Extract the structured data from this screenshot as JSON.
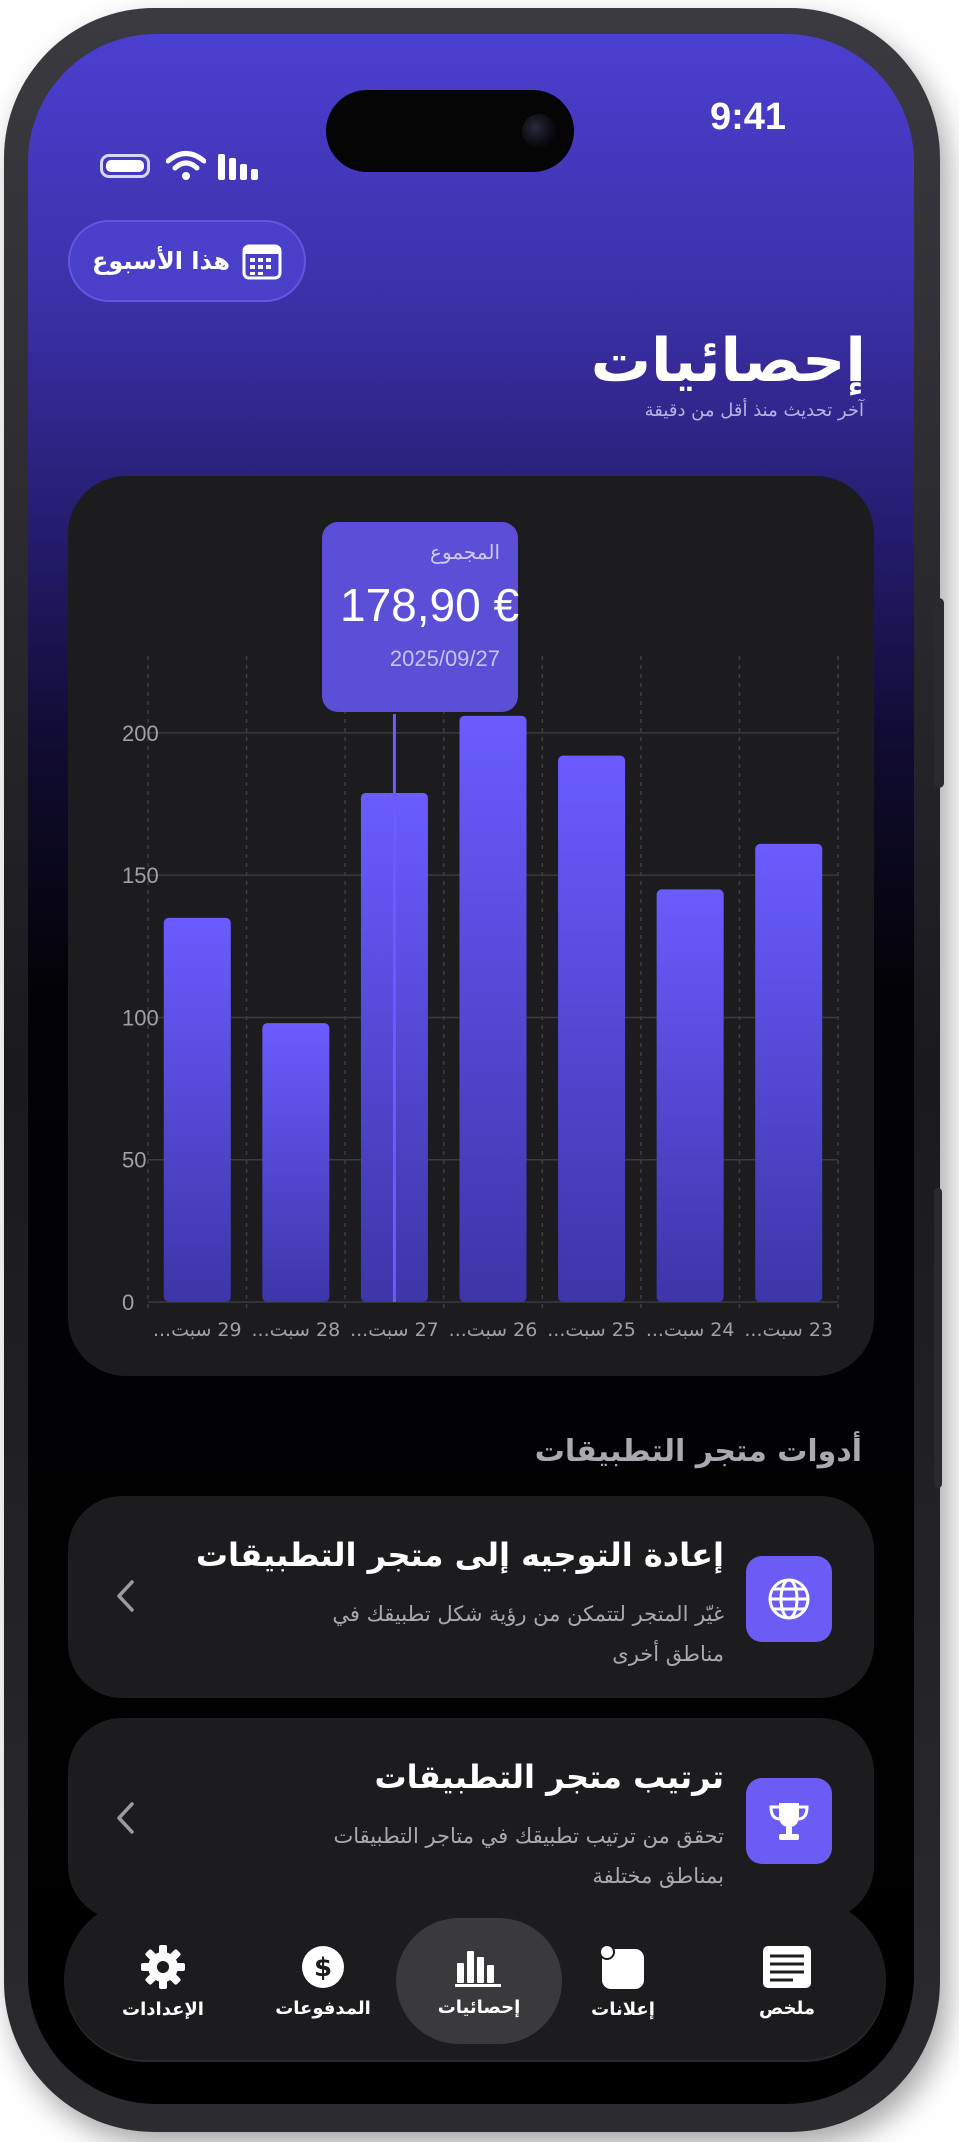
{
  "status_bar": {
    "time": "9:41"
  },
  "header": {
    "period_button": "هذا الأسبوع",
    "title": "إحصائيات",
    "subtitle": "آخر تحديث منذ أقل من دقيقة"
  },
  "tooltip": {
    "label": "المجموع",
    "value": "178,90 €",
    "date": "2025/09/27"
  },
  "chart_data": {
    "type": "bar",
    "categories": [
      "23 سبت...",
      "24 سبت...",
      "25 سبت...",
      "26 سبت...",
      "27 سبت...",
      "28 سبت...",
      "29 سبت..."
    ],
    "values": [
      161,
      145,
      192,
      206,
      178.9,
      98,
      135
    ],
    "ylim": [
      0,
      220
    ],
    "yticks": [
      "0",
      "50",
      "100",
      "150",
      "200"
    ],
    "grid": true,
    "selected_index": 4,
    "colors": {
      "bar_top": "#6a5cff",
      "bar_bottom": "#3d35a8"
    }
  },
  "tools_section": {
    "title": "أدوات متجر التطبيقات",
    "items": [
      {
        "title": "إعادة التوجيه إلى متجر التطبيقات",
        "description": "غيّر المتجر لتتمكن من رؤية شكل تطبيقك في مناطق أخرى",
        "icon": "globe-icon"
      },
      {
        "title": "ترتيب متجر التطبيقات",
        "description": "تحقق من ترتيب تطبيقك في متاجر التطبيقات بمناطق مختلفة",
        "icon": "trophy-icon"
      }
    ]
  },
  "tabbar": {
    "summary": "ملخص",
    "ads": "إعلانات",
    "stats": "إحصائيات",
    "payments": "المدفوعات",
    "settings": "الإعدادات",
    "active": "stats"
  },
  "colors": {
    "accent": "#6b5cf6",
    "card": "#1c1c1e"
  }
}
